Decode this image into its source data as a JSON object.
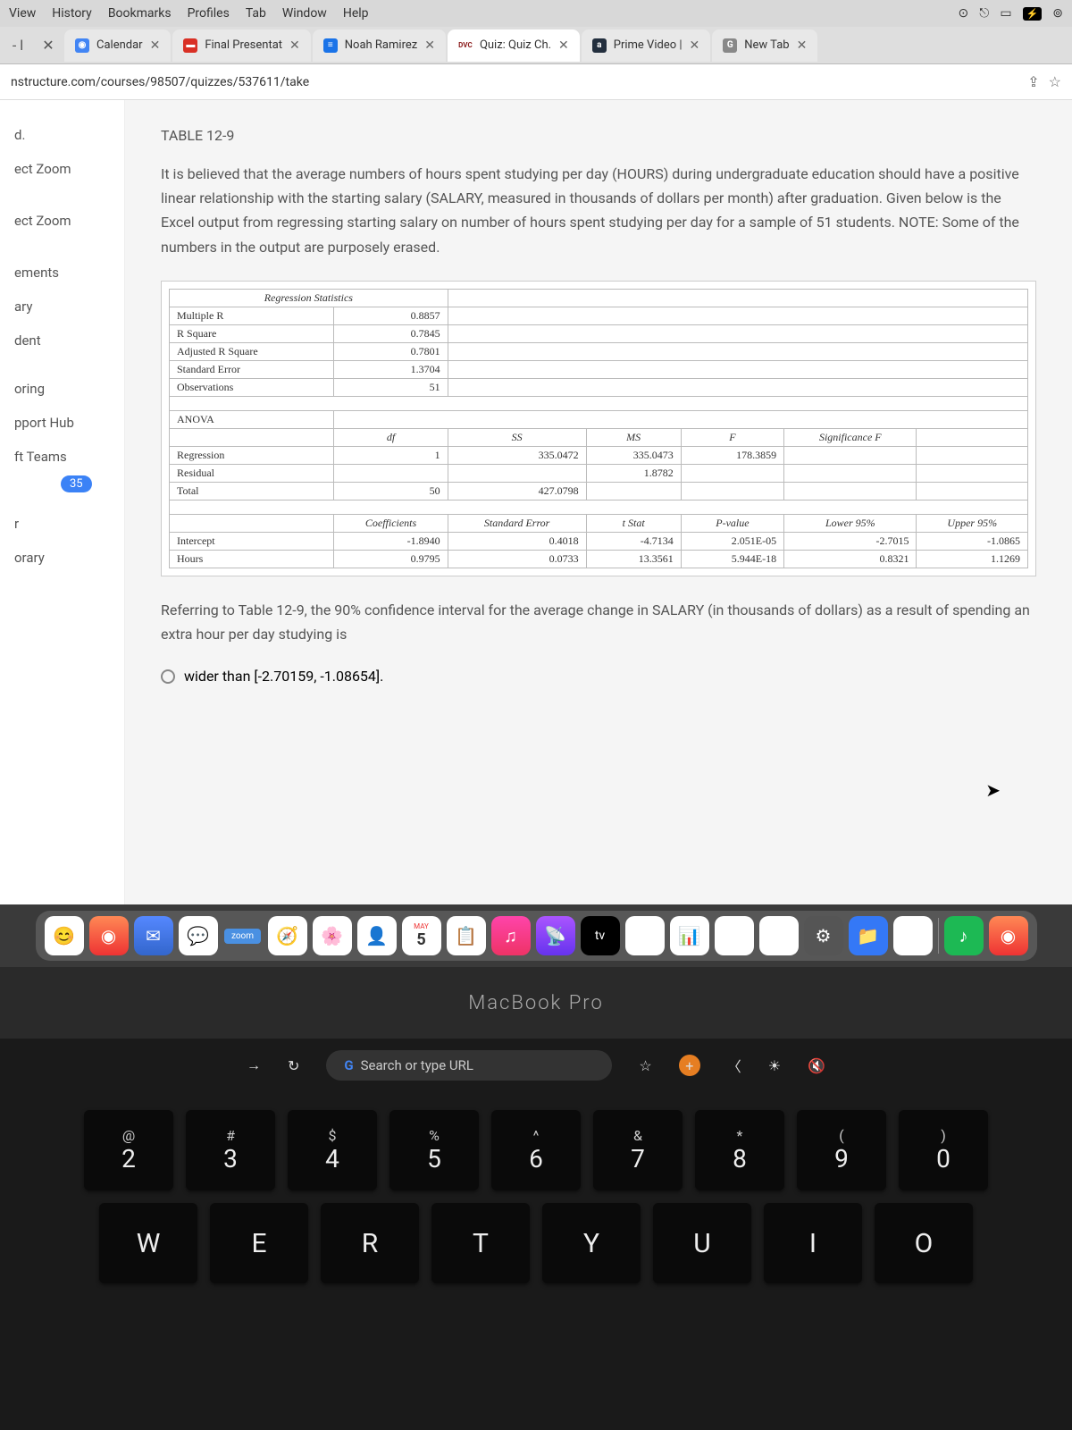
{
  "menubar": {
    "items": [
      "View",
      "History",
      "Bookmarks",
      "Profiles",
      "Tab",
      "Window",
      "Help"
    ]
  },
  "tabs": [
    {
      "label": "",
      "icon": "←",
      "nav": true
    },
    {
      "label": "Calendar",
      "iconBg": "#4285f4",
      "iconText": "G"
    },
    {
      "label": "Final Presentat",
      "iconBg": "#d93025",
      "iconText": "■"
    },
    {
      "label": "Noah Ramirez",
      "iconBg": "#1a73e8",
      "iconText": "≡"
    },
    {
      "label": "Quiz: Quiz Ch.",
      "iconBg": "#fff",
      "iconText": "DVC",
      "active": true,
      "textDark": true
    },
    {
      "label": "Prime Video |",
      "iconBg": "#232f3e",
      "iconText": "a"
    },
    {
      "label": "New Tab",
      "iconBg": "#888",
      "iconText": "G"
    }
  ],
  "url": "nstructure.com/courses/98507/quizzes/537611/take",
  "sidebar": {
    "items": [
      "d.",
      "ect Zoom",
      "ect Zoom",
      "ements",
      "ary",
      "dent",
      "oring",
      "pport Hub",
      "ft Teams",
      "r",
      "orary"
    ],
    "badge": "35"
  },
  "content": {
    "tableTitle": "TABLE 12-9",
    "intro": "It is believed that the average numbers of hours spent studying per day (HOURS) during undergraduate education should have a positive linear relationship with the starting salary (SALARY, measured in thousands of dollars per month) after graduation. Given below is the Excel output from regressing starting salary on number of hours spent studying per day for a sample of 51 students. NOTE: Some of the numbers in the output are purposely erased.",
    "regStats": {
      "title": "Regression Statistics",
      "rows": [
        [
          "Multiple R",
          "0.8857"
        ],
        [
          "R Square",
          "0.7845"
        ],
        [
          "Adjusted R Square",
          "0.7801"
        ],
        [
          "Standard Error",
          "1.3704"
        ],
        [
          "Observations",
          "51"
        ]
      ]
    },
    "anova": {
      "title": "ANOVA",
      "headers": [
        "",
        "df",
        "SS",
        "MS",
        "F",
        "Significance F"
      ],
      "rows": [
        [
          "Regression",
          "1",
          "335.0472",
          "335.0473",
          "178.3859",
          ""
        ],
        [
          "Residual",
          "",
          "",
          "1.8782",
          "",
          ""
        ],
        [
          "Total",
          "50",
          "427.0798",
          "",
          "",
          ""
        ]
      ]
    },
    "coef": {
      "headers": [
        "",
        "Coefficients",
        "Standard Error",
        "t Stat",
        "P-value",
        "Lower 95%",
        "Upper 95%"
      ],
      "rows": [
        [
          "Intercept",
          "-1.8940",
          "0.4018",
          "-4.7134",
          "2.051E-05",
          "-2.7015",
          "-1.0865"
        ],
        [
          "Hours",
          "0.9795",
          "0.0733",
          "13.3561",
          "5.944E-18",
          "0.8321",
          "1.1269"
        ]
      ]
    },
    "question": "Referring to Table 12-9, the 90% confidence interval for the average change in SALARY (in thousands of dollars) as a result of spending an extra hour per day studying is",
    "option1": "wider than [-2.70159, -1.08654]."
  },
  "dock": {
    "zoom": "zoom",
    "cal_month": "MAY",
    "cal_day": "5",
    "tv": "tv"
  },
  "macbook": "MacBook Pro",
  "touchbar": {
    "search": "Search or type URL"
  },
  "keys": {
    "row1": [
      {
        "top": "@",
        "main": "2"
      },
      {
        "top": "#",
        "main": "3"
      },
      {
        "top": "$",
        "main": "4"
      },
      {
        "top": "%",
        "main": "5"
      },
      {
        "top": "^",
        "main": "6"
      },
      {
        "top": "&",
        "main": "7"
      },
      {
        "top": "*",
        "main": "8"
      },
      {
        "top": "(",
        "main": "9"
      },
      {
        "top": ")",
        "main": "0"
      }
    ],
    "row2": [
      "W",
      "E",
      "R",
      "T",
      "Y",
      "U",
      "I",
      "O"
    ]
  }
}
